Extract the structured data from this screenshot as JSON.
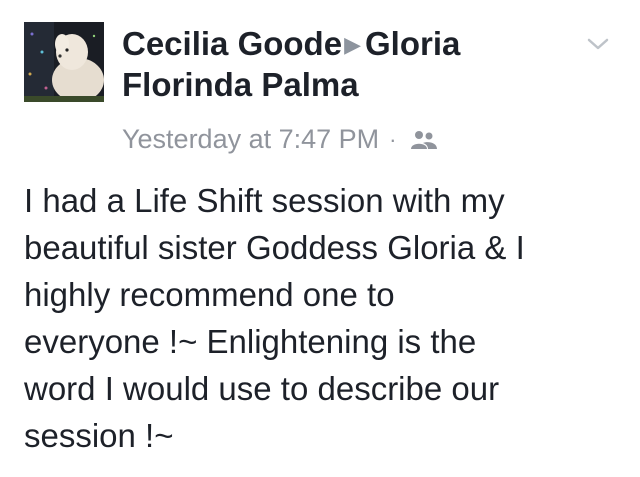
{
  "post": {
    "author": "Cecilia Goode",
    "target_line1": "Gloria",
    "target_line2": "Florinda Palma",
    "timestamp": "Yesterday at 7:47 PM",
    "separator": "·",
    "audience_icon": "friends-icon",
    "options_icon": "chevron-down-icon",
    "body_lines": [
      "I had a Life Shift session with my",
      "beautiful sister Goddess Gloria & I",
      "highly recommend one to",
      "everyone !~ Enlightening is the",
      "word I would use to describe our",
      "session !~"
    ]
  },
  "colors": {
    "text": "#1d2129",
    "meta": "#90949c",
    "arrow": "#8d949e"
  }
}
